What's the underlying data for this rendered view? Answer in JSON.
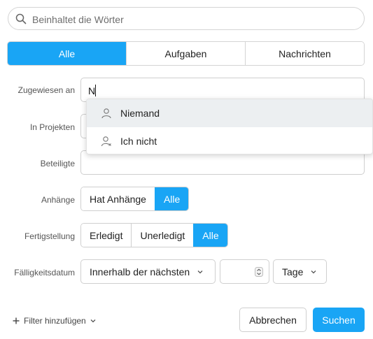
{
  "search": {
    "placeholder": "Beinhaltet die Wörter",
    "value": ""
  },
  "tabs": [
    {
      "label": "Alle",
      "active": true
    },
    {
      "label": "Aufgaben",
      "active": false
    },
    {
      "label": "Nachrichten",
      "active": false
    }
  ],
  "form": {
    "assigned_label": "Zugewiesen an",
    "assigned_value": "N",
    "projects_label": "In Projekten",
    "participants_label": "Beteiligte",
    "attachments_label": "Anhänge",
    "attachments_options": [
      "Hat Anhänge",
      "Alle"
    ],
    "completion_label": "Fertigstellung",
    "completion_options": [
      "Erledigt",
      "Unerledigt",
      "Alle"
    ],
    "due_label": "Fälligkeitsdatum",
    "due_range": "Innerhalb der nächsten",
    "due_number": "",
    "due_unit": "Tage"
  },
  "dropdown": [
    {
      "label": "Niemand",
      "icon": "person-icon",
      "highlighted": true
    },
    {
      "label": "Ich nicht",
      "icon": "person-x-icon",
      "highlighted": false
    }
  ],
  "footer": {
    "add_filter": "Filter hinzufügen",
    "cancel": "Abbrechen",
    "submit": "Suchen"
  },
  "colors": {
    "accent": "#19a5f5",
    "border": "#cfcfcf",
    "highlight": "#eceff1"
  }
}
